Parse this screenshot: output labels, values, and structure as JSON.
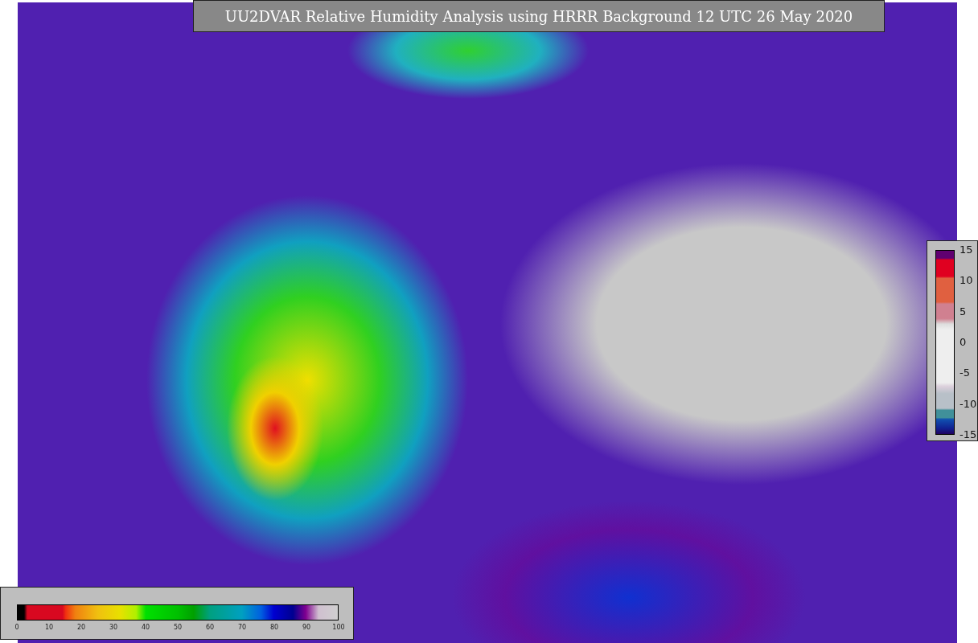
{
  "title": "UU2DVAR Relative Humidity Analysis using HRRR Background 12 UTC 26 May 2020",
  "humidity_colorbar": {
    "ticks": [
      "0",
      "10",
      "20",
      "30",
      "40",
      "50",
      "60",
      "70",
      "80",
      "90",
      "100"
    ]
  },
  "difference_colorbar": {
    "ticks": [
      "15",
      "10",
      "5",
      "0",
      "-5",
      "-10",
      "-15"
    ]
  }
}
